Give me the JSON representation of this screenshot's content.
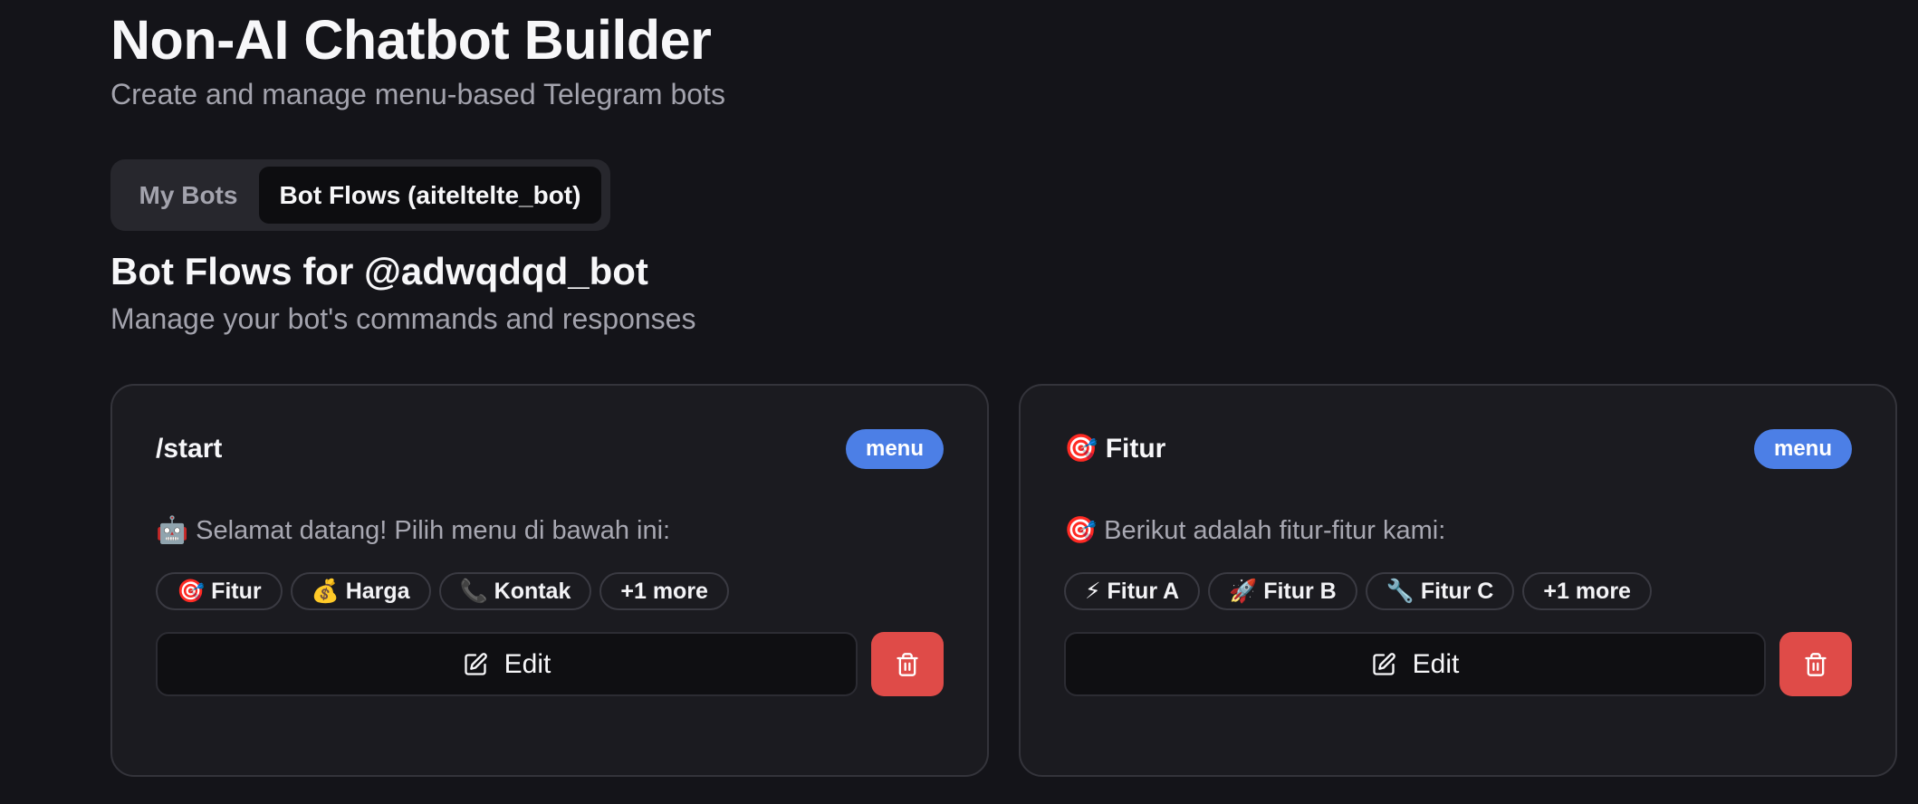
{
  "header": {
    "title": "Non-AI Chatbot Builder",
    "subtitle": "Create and manage menu-based Telegram bots"
  },
  "tabs": [
    {
      "label": "My Bots",
      "active": false
    },
    {
      "label": "Bot Flows (aiteltelte_bot)",
      "active": true
    }
  ],
  "section": {
    "title": "Bot Flows for @adwqdqd_bot",
    "subtitle": "Manage your bot's commands and responses"
  },
  "flows": [
    {
      "title": "/start",
      "badge": "menu",
      "message": "🤖 Selamat datang! Pilih menu di bawah ini:",
      "buttons": [
        "🎯 Fitur",
        "💰 Harga",
        "📞 Kontak"
      ],
      "more": "+1 more",
      "edit_label": "Edit"
    },
    {
      "title": "🎯 Fitur",
      "badge": "menu",
      "message": "🎯 Berikut adalah fitur-fitur kami:",
      "buttons": [
        "⚡ Fitur A",
        "🚀 Fitur B",
        "🔧 Fitur C"
      ],
      "more": "+1 more",
      "edit_label": "Edit"
    }
  ],
  "icons": {
    "edit": "pencil-square-icon",
    "delete": "trash-icon"
  },
  "colors": {
    "background": "#141419",
    "card": "#1b1b20",
    "badge": "#4c7fe6",
    "delete": "#df4b48"
  }
}
